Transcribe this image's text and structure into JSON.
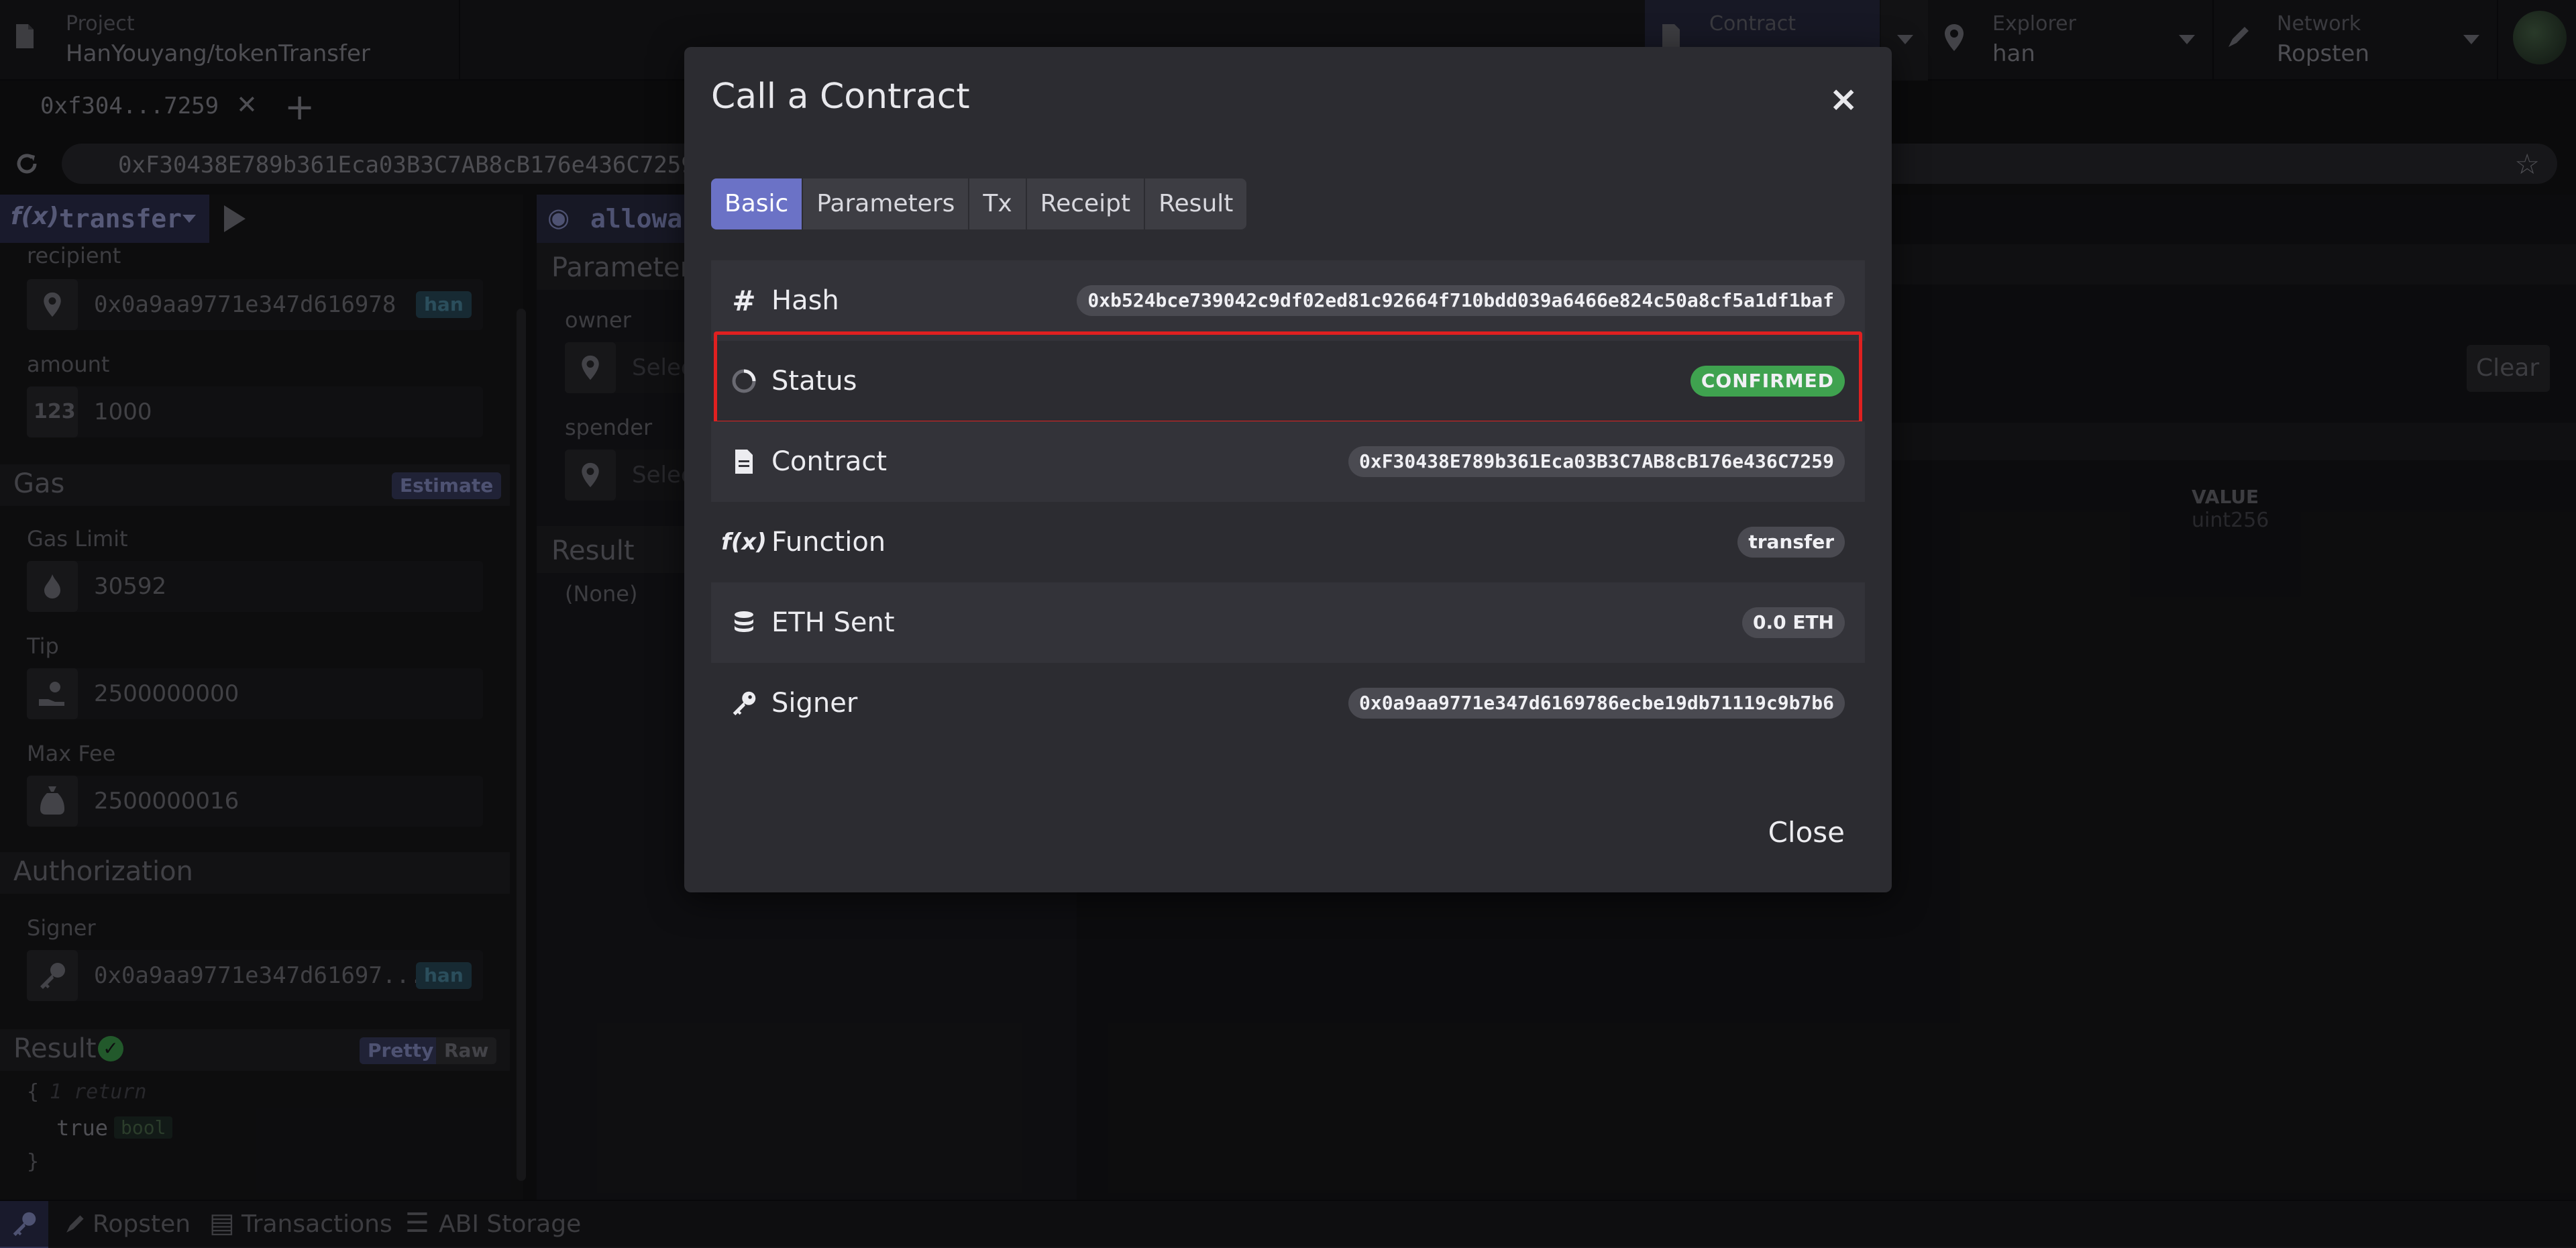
{
  "topbar": {
    "project_label": "Project",
    "project_name": "HanYouyang/tokenTransfer",
    "contract_label": "Contract",
    "explorer_label": "Explorer",
    "explorer_value": "han",
    "network_label": "Network",
    "network_value": "Ropsten"
  },
  "tabs_bar": {
    "tab_label": "0xf304...7259"
  },
  "urlbar": {
    "address": "0xF30438E789b361Eca03B3C7AB8cB176e436C7259"
  },
  "left": {
    "function_name": "transfer",
    "recipient_label": "recipient",
    "recipient_value": "0x0a9aa9771e347d616978",
    "recipient_tag": "han",
    "amount_label": "amount",
    "amount_icon_text": "123",
    "amount_value": "1000",
    "gas_title": "Gas",
    "estimate_label": "Estimate",
    "gas_limit_label": "Gas Limit",
    "gas_limit_value": "30592",
    "tip_label": "Tip",
    "tip_value": "2500000000",
    "max_fee_label": "Max Fee",
    "max_fee_value": "2500000016",
    "auth_title": "Authorization",
    "signer_label": "Signer",
    "signer_value": "0x0a9aa9771e347d61697...",
    "signer_tag": "han",
    "result_title": "Result",
    "pretty_label": "Pretty",
    "raw_label": "Raw",
    "result_line1": "{",
    "result_comment": "1 return",
    "result_value": "true",
    "result_type": "bool",
    "result_line4": "}"
  },
  "middle": {
    "function_name": "allowance",
    "params_title": "Parameters",
    "owner_label": "owner",
    "spender_label": "spender",
    "select_placeholder": "Select",
    "result_title": "Result",
    "result_value": "(None)"
  },
  "right": {
    "clear_label": "Clear",
    "value_header": "VALUE",
    "value_type": "uint256"
  },
  "bottombar": {
    "network": "Ropsten",
    "transactions": "Transactions",
    "abi_storage": "ABI Storage"
  },
  "modal": {
    "title": "Call a Contract",
    "tabs": [
      "Basic",
      "Parameters",
      "Tx",
      "Receipt",
      "Result"
    ],
    "rows": [
      {
        "label": "Hash",
        "value": "0xb524bce739042c9df02ed81c92664f710bdd039a6466e824c50a8cf5a1df1baf",
        "icon": "hash-icon"
      },
      {
        "label": "Status",
        "value": "CONFIRMED",
        "icon": "spinner-icon"
      },
      {
        "label": "Contract",
        "value": "0xF30438E789b361Eca03B3C7AB8cB176e436C7259",
        "icon": "file-icon"
      },
      {
        "label": "Function",
        "value": "transfer",
        "icon": "function-icon"
      },
      {
        "label": "ETH Sent",
        "value": "0.0 ETH",
        "icon": "coins-icon"
      },
      {
        "label": "Signer",
        "value": "0x0a9aa9771e347d6169786ecbe19db71119c9b7b6",
        "icon": "key-icon"
      }
    ],
    "close_label": "Close",
    "status_color": "#3fa24f",
    "accent_color": "#6b72c6",
    "highlight_color": "#e02020"
  }
}
